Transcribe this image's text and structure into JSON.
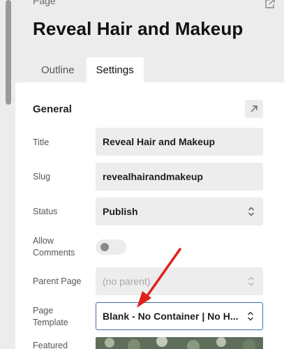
{
  "header": {
    "kicker": "Page",
    "title": "Reveal Hair and Makeup"
  },
  "tabs": [
    {
      "label": "Outline",
      "active": false
    },
    {
      "label": "Settings",
      "active": true
    }
  ],
  "section": {
    "title": "General"
  },
  "fields": {
    "title": {
      "label": "Title",
      "value": "Reveal Hair and Makeup"
    },
    "slug": {
      "label": "Slug",
      "value": "revealhairandmakeup"
    },
    "status": {
      "label": "Status",
      "value": "Publish"
    },
    "allow_comments": {
      "label_line1": "Allow",
      "label_line2": "Comments",
      "enabled": false
    },
    "parent_page": {
      "label": "Parent Page",
      "value": "(no parent)"
    },
    "page_template": {
      "label_line1": "Page",
      "label_line2": "Template",
      "value": "Blank - No Container | No H..."
    },
    "featured_image": {
      "label": "Featured"
    }
  },
  "colors": {
    "accent_border": "#3e6ea8",
    "annotation_arrow": "#e0201b"
  },
  "icons": {
    "open_external": "external-link-icon",
    "select": "chevron-updown-icon"
  }
}
